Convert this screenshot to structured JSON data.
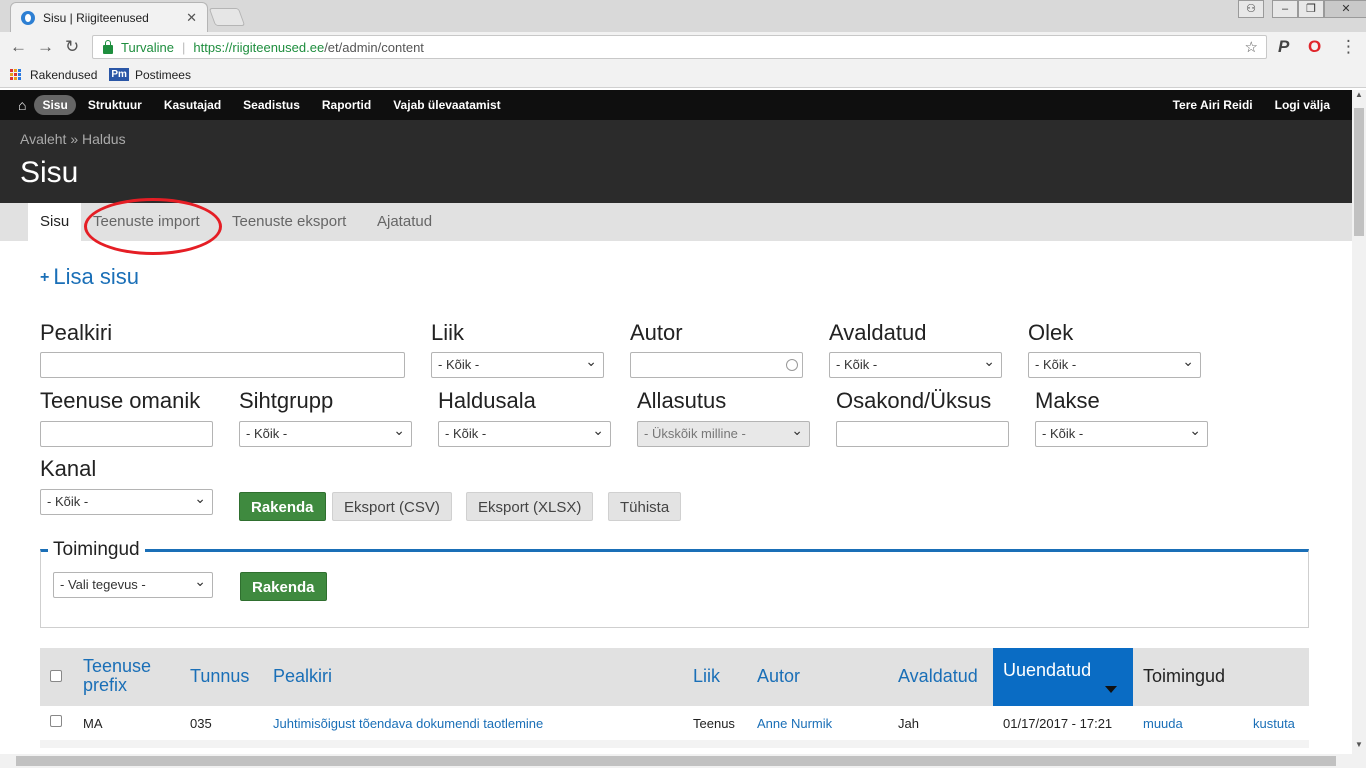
{
  "browser": {
    "tab_title": "Sisu | Riigiteenused",
    "tab_close": "✕",
    "secure_label": "Turvaline",
    "url_host": "https://riigiteenused.ee",
    "url_path": "/et/admin/content",
    "bookmarks": [
      "Rakendused",
      "Postimees"
    ],
    "pm_logo": "Pm"
  },
  "admin_toolbar": {
    "items": [
      "Sisu",
      "Struktuur",
      "Kasutajad",
      "Seadistus",
      "Raportid",
      "Vajab ülevaatamist"
    ],
    "greeting": "Tere Airi Reidi",
    "logout": "Logi välja"
  },
  "header": {
    "breadcrumb": "Avaleht » Haldus",
    "title": "Sisu"
  },
  "tabs": [
    "Sisu",
    "Teenuste import",
    "Teenuste eksport",
    "Ajatatud"
  ],
  "add_content": {
    "plus": "+",
    "label": "Lisa sisu"
  },
  "filters": {
    "pealkiri": "Pealkiri",
    "liik": "Liik",
    "autor": "Autor",
    "avaldatud": "Avaldatud",
    "olek": "Olek",
    "teenuse_omanik": "Teenuse omanik",
    "sihtgrupp": "Sihtgrupp",
    "haldusala": "Haldusala",
    "allasutus": "Allasutus",
    "osakond": "Osakond/Üksus",
    "makse": "Makse",
    "kanal": "Kanal",
    "any": "- Kõik -",
    "allasutus_value": "- Ükskõik milline -"
  },
  "buttons": {
    "apply": "Rakenda",
    "export_csv": "Eksport (CSV)",
    "export_xlsx": "Eksport (XLSX)",
    "reset": "Tühista"
  },
  "actions": {
    "legend": "Toimingud",
    "select": "- Vali tegevus -",
    "apply": "Rakenda"
  },
  "table": {
    "headers": {
      "prefix": "Teenuse prefix",
      "tunnus": "Tunnus",
      "pealkiri": "Pealkiri",
      "liik": "Liik",
      "autor": "Autor",
      "avaldatud": "Avaldatud",
      "uuendatud": "Uuendatud",
      "toimingud": "Toimingud"
    },
    "rows": [
      {
        "prefix": "MA",
        "tunnus": "035",
        "pealkiri": "Juhtimisõigust tõendava dokumendi taotlemine",
        "liik": "Teenus",
        "autor": "Anne Nurmik",
        "avaldatud": "Jah",
        "uuendatud": "01/17/2017 - 17:21",
        "edit": "muuda",
        "delete": "kustuta"
      }
    ]
  },
  "colors": {
    "accent": "#1a6fb7",
    "apply_green": "#3f8a3f",
    "sorted_header": "#0a6cc4",
    "highlight_circle": "#e51e25"
  }
}
